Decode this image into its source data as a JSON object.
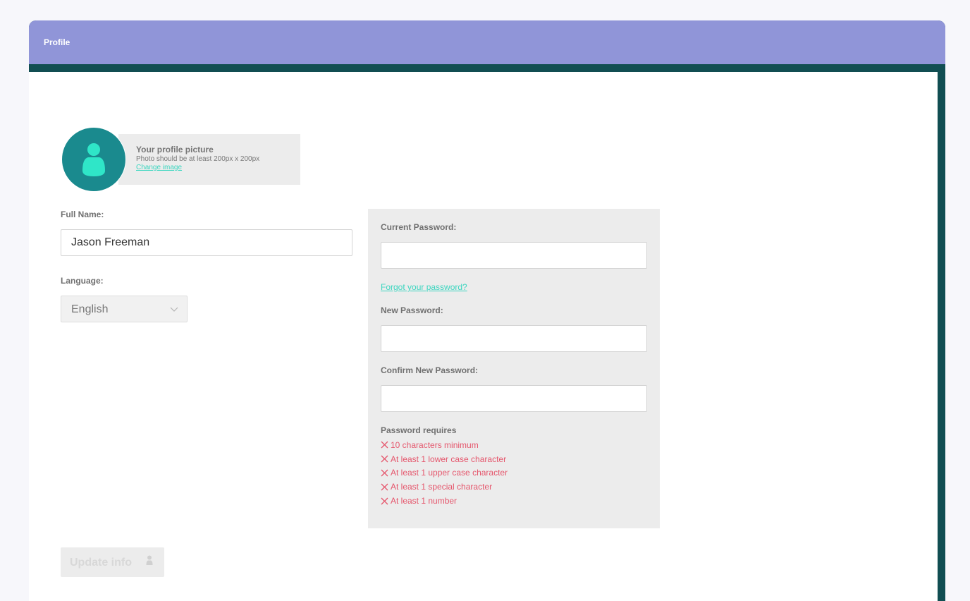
{
  "header": {
    "title": "Profile"
  },
  "profile_picture": {
    "title": "Your profile picture",
    "hint": "Photo should be at least 200px x 200px",
    "change_link": "Change image"
  },
  "full_name": {
    "label": "Full Name:",
    "value": "Jason Freeman"
  },
  "language": {
    "label": "Language:",
    "selected": "English"
  },
  "password": {
    "current_label": "Current Password:",
    "forgot_link": "Forgot your password?",
    "new_label": "New Password:",
    "confirm_label": "Confirm New Password:",
    "requirements_title": "Password requires",
    "requirements": [
      "10 characters minimum",
      "At least 1 lower case character",
      "At least 1 upper case character",
      "At least 1 special character",
      "At least 1 number"
    ]
  },
  "update_button": {
    "label": "Update info",
    "icon": "user-icon"
  },
  "colors": {
    "header": "#9095d8",
    "frame": "#114e52",
    "avatar": "#1a8a8e",
    "accent": "#3dd6c0",
    "error": "#e5566c"
  }
}
